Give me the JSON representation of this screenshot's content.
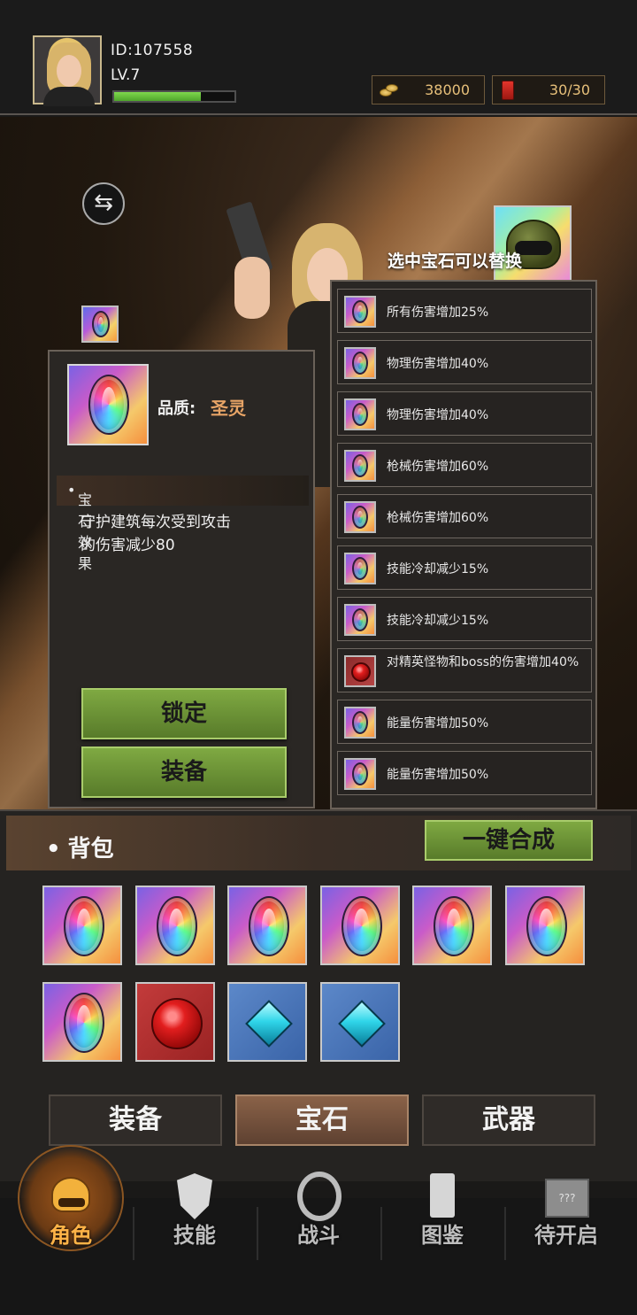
{
  "player": {
    "id": "ID:107558",
    "level": "LV.7",
    "xp_fraction": 0.72
  },
  "resources": {
    "coins": "38000",
    "energy": "30/30"
  },
  "scene": {
    "hint": "选中宝石可以替换"
  },
  "detail": {
    "quality_label": "品质:",
    "quality_value": "圣灵",
    "effect_title": "宝石效果",
    "effect_text": "守护建筑每次受到攻击\n的伤害减少80",
    "lock_label": "锁定",
    "equip_label": "装备"
  },
  "gem_list": [
    {
      "type": "rainbow",
      "label": "所有伤害增加25%"
    },
    {
      "type": "rainbow",
      "label": "物理伤害增加40%"
    },
    {
      "type": "rainbow",
      "label": "物理伤害增加40%"
    },
    {
      "type": "rainbow",
      "label": "枪械伤害增加60%"
    },
    {
      "type": "rainbow",
      "label": "枪械伤害增加60%"
    },
    {
      "type": "rainbow",
      "label": "技能冷却减少15%"
    },
    {
      "type": "rainbow",
      "label": "技能冷却减少15%"
    },
    {
      "type": "red",
      "label": "对精英怪物和boss的伤害增加40%"
    },
    {
      "type": "rainbow",
      "label": "能量伤害增加50%"
    },
    {
      "type": "rainbow",
      "label": "能量伤害增加50%"
    }
  ],
  "bag": {
    "title": "背包",
    "merge_label": "一键合成",
    "items": [
      "rainbow",
      "rainbow",
      "rainbow",
      "rainbow",
      "rainbow",
      "rainbow",
      "rainbow",
      "red",
      "blue",
      "blue"
    ]
  },
  "categories": [
    {
      "label": "装备",
      "active": false
    },
    {
      "label": "宝石",
      "active": true
    },
    {
      "label": "武器",
      "active": false
    }
  ],
  "nav": [
    {
      "label": "角色",
      "icon": "helmet-icon",
      "active": true
    },
    {
      "label": "技能",
      "icon": "shield-icon",
      "active": false
    },
    {
      "label": "战斗",
      "icon": "battle-icon",
      "active": false
    },
    {
      "label": "图鉴",
      "icon": "book-icon",
      "active": false
    },
    {
      "label": "待开启",
      "icon": "mystery-box-icon",
      "active": false
    }
  ],
  "colors": {
    "accent_gold": "#e7c07a",
    "quality_orange": "#e7a466",
    "button_green": "#6f973a",
    "nav_active": "#ffb347"
  }
}
